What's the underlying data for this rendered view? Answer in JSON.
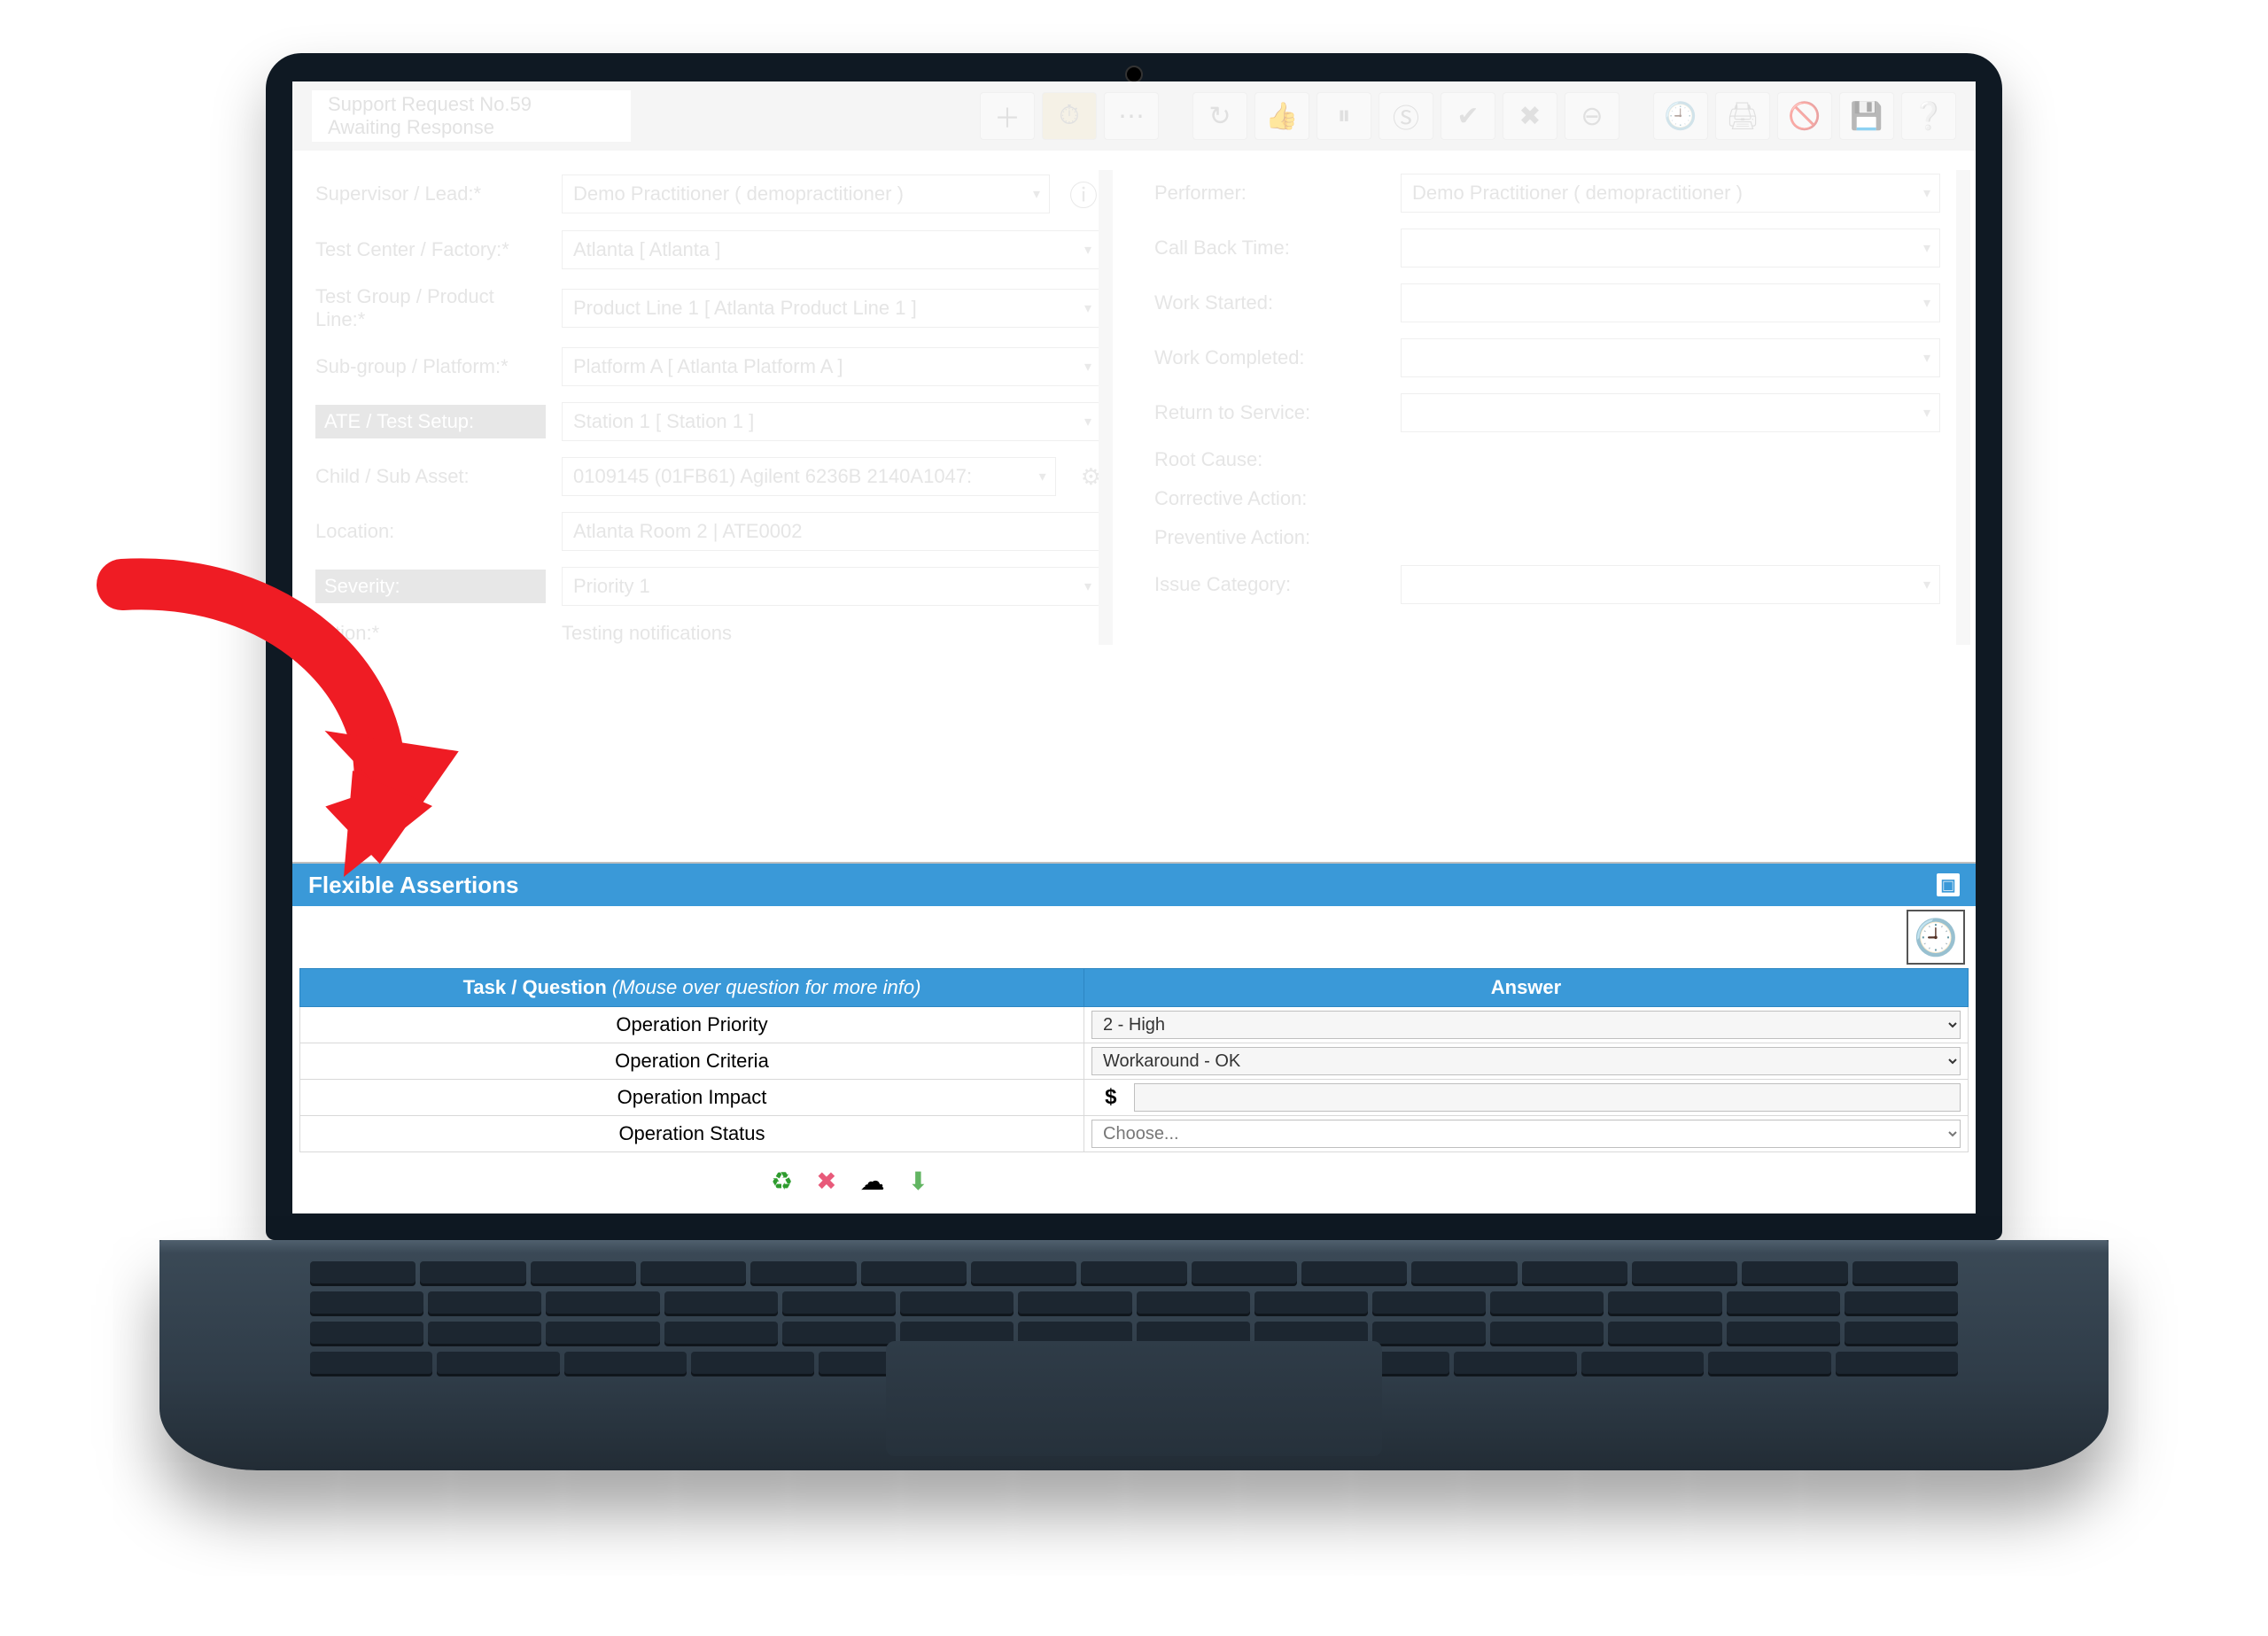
{
  "colors": {
    "accent": "#3a99d8",
    "arrow": "#ef1c24"
  },
  "title": {
    "line1": "Support Request No.59",
    "line2": "Awaiting Response"
  },
  "left": [
    {
      "label": "Supervisor / Lead:*",
      "value": "Demo Practitioner ( demopractitioner )",
      "info": true
    },
    {
      "label": "Test Center / Factory:*",
      "value": "Atlanta [ Atlanta ]"
    },
    {
      "label": "Test Group / Product Line:*",
      "value": "Product Line 1 [ Atlanta Product Line 1 ]"
    },
    {
      "label": "Sub-group / Platform:*",
      "value": "Platform A [ Atlanta Platform A ]"
    },
    {
      "label": "ATE / Test Setup:",
      "value": "Station 1 [ Station 1 ]",
      "hl": true
    },
    {
      "label": "Child / Sub Asset:",
      "value": "0109145 (01FB61) Agilent 6236B 2140A1047:",
      "gear": true
    },
    {
      "label": "Location:",
      "value": "Atlanta Room 2 |  ATE0002",
      "plain": true
    },
    {
      "label": "Severity:",
      "value": "Priority 1",
      "hl": true,
      "partial": true
    },
    {
      "label": "…tion:*",
      "value": "Testing notifications",
      "textOnly": true,
      "partial": true
    }
  ],
  "right": [
    {
      "label": "Performer:",
      "value": "Demo Practitioner ( demopractitioner )"
    },
    {
      "label": "Call Back Time:",
      "value": ""
    },
    {
      "label": "Work Started:",
      "value": ""
    },
    {
      "label": "Work Completed:",
      "value": ""
    },
    {
      "label": "Return to Service:",
      "value": ""
    },
    {
      "label": "Root Cause:",
      "value": "",
      "noInput": true
    },
    {
      "label": "Corrective Action:",
      "value": "",
      "noInput": true
    },
    {
      "label": "Preventive Action:",
      "value": "",
      "noInput": true
    },
    {
      "label": "Issue Category:",
      "value": ""
    }
  ],
  "panel": {
    "title": "Flexible Assertions",
    "th1": "Task / Question",
    "th1hint": "(Mouse over question for more info)",
    "th2": "Answer",
    "rows": [
      {
        "q": "Operation Priority",
        "type": "select",
        "value": "2 - High"
      },
      {
        "q": "Operation Criteria",
        "type": "select",
        "value": "Workaround - OK"
      },
      {
        "q": "Operation Impact",
        "type": "money",
        "sym": "$",
        "value": ""
      },
      {
        "q": "Operation Status",
        "type": "select",
        "value": "Choose...",
        "wide": true
      }
    ]
  }
}
